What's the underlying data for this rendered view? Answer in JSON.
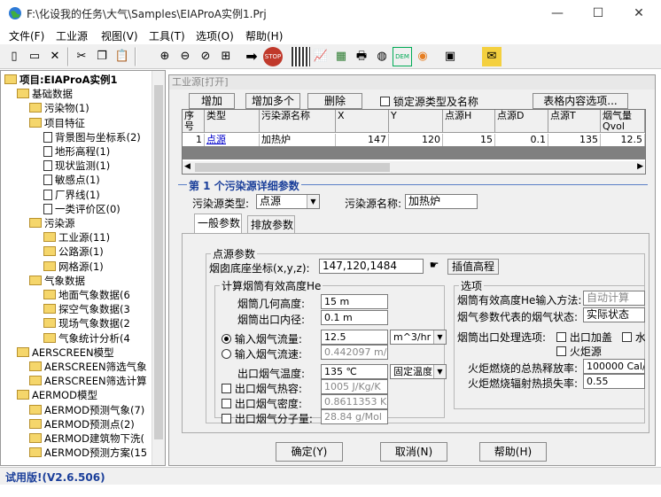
{
  "window": {
    "title": "F:\\化设我的任务\\大气\\Samples\\EIAProA实例1.Prj",
    "min": "—",
    "max": "☐",
    "close": "✕"
  },
  "menu": [
    "文件(F)",
    "工业源",
    "视图(V)",
    "工具(T)",
    "选项(O)",
    "帮助(H)"
  ],
  "toolbar": {
    "icons": [
      "new-icon",
      "open-icon",
      "delete-icon",
      "cut-icon",
      "copy-icon",
      "paste-icon",
      "zoom-in-icon",
      "zoom-out-icon",
      "zoom-fit-icon",
      "zoom-window-icon",
      "arrow-icon",
      "stop-icon",
      "grid-icon",
      "chart-icon",
      "calc-icon",
      "print-icon",
      "globe-icon",
      "dem-icon",
      "color-icon",
      "export-icon",
      "map-icon"
    ],
    "stop": "STOP",
    "dem": "DEM"
  },
  "tree": {
    "items": [
      {
        "label": "项目:EIAProA实例1",
        "type": "folder",
        "level": 0,
        "bold": true
      },
      {
        "label": "基础数据",
        "type": "folder",
        "level": 1
      },
      {
        "label": "污染物(1)",
        "type": "folder",
        "level": 2
      },
      {
        "label": "项目特征",
        "type": "folder",
        "level": 2
      },
      {
        "label": "背景图与坐标系(2)",
        "type": "doc",
        "level": 3
      },
      {
        "label": "地形高程(1)",
        "type": "doc",
        "level": 3
      },
      {
        "label": "现状监测(1)",
        "type": "doc",
        "level": 3
      },
      {
        "label": "敏感点(1)",
        "type": "doc",
        "level": 3
      },
      {
        "label": "厂界线(1)",
        "type": "doc",
        "level": 3
      },
      {
        "label": "一类评价区(0)",
        "type": "doc",
        "level": 3
      },
      {
        "label": "污染源",
        "type": "folder",
        "level": 2
      },
      {
        "label": "工业源(11)",
        "type": "folder",
        "level": 3
      },
      {
        "label": "公路源(1)",
        "type": "folder",
        "level": 3
      },
      {
        "label": "网格源(1)",
        "type": "folder",
        "level": 3
      },
      {
        "label": "气象数据",
        "type": "folder",
        "level": 2
      },
      {
        "label": "地面气象数据(6",
        "type": "folder",
        "level": 3
      },
      {
        "label": "探空气象数据(3",
        "type": "folder",
        "level": 3
      },
      {
        "label": "现场气象数据(2",
        "type": "folder",
        "level": 3
      },
      {
        "label": "气象统计分析(4",
        "type": "folder",
        "level": 3
      },
      {
        "label": "AERSCREEN模型",
        "type": "folder",
        "level": 1
      },
      {
        "label": "AERSCREEN筛选气象",
        "type": "folder",
        "level": 2
      },
      {
        "label": "AERSCREEN筛选计算",
        "type": "folder",
        "level": 2
      },
      {
        "label": "AERMOD模型",
        "type": "folder",
        "level": 1
      },
      {
        "label": "AERMOD预测气象(7)",
        "type": "folder",
        "level": 2
      },
      {
        "label": "AERMOD预测点(2)",
        "type": "folder",
        "level": 2
      },
      {
        "label": "AERMOD建筑物下洗(",
        "type": "folder",
        "level": 2
      },
      {
        "label": "AERMOD预测方案(15",
        "type": "folder",
        "level": 2
      }
    ]
  },
  "panel": {
    "title": "工业源[打开]",
    "buttons": {
      "add": "增加",
      "add_multi": "增加多个",
      "delete": "删除",
      "lock": "锁定源类型及名称",
      "table_options": "表格内容选项..."
    },
    "grid": {
      "headers": [
        "序号",
        "类型",
        "污染源名称",
        "X",
        "Y",
        "点源H",
        "点源D",
        "点源T",
        "烟气量Qvol"
      ],
      "row": [
        "1",
        "点源",
        "加热炉",
        "147",
        "120",
        "15",
        "0.1",
        "135",
        "12.5"
      ]
    },
    "detail_title": "第 1 个污染源详细参数",
    "source_type_label": "污染源类型:",
    "source_type": "点源",
    "source_name_label": "污染源名称:",
    "source_name": "加热炉",
    "tabs": [
      "一般参数",
      "排放参数"
    ],
    "point_group": "点源参数",
    "base_coord_label": "烟囱底座坐标(x,y,z):",
    "base_coord": "147,120,1484",
    "interp_btn": "插值高程",
    "calc_group": "计算烟筒有效高度He",
    "stack_h_label": "烟筒几何高度:",
    "stack_h": "15 m",
    "stack_d_label": "烟筒出口内径:",
    "stack_d": "0.1 m",
    "flow_label": "输入烟气流量:",
    "flow": "12.5",
    "flow_unit": "m^3/hr",
    "vel_label": "输入烟气流速:",
    "vel": "0.442097 m/s",
    "temp_label": "出口烟气温度:",
    "temp": "135 ℃",
    "temp_mode": "固定温度",
    "cp_label": "出口烟气热容:",
    "cp": "1005 J/Kg/K",
    "dens_label": "出口烟气密度:",
    "dens": "0.8611353 Kg",
    "mw_label": "出口烟气分子量:",
    "mw": "28.84 g/Mol",
    "opt_group": "选项",
    "he_method_label": "烟筒有效高度He输入方法:",
    "he_method": "自动计算",
    "state_label": "烟气参数代表的烟气状态:",
    "state": "实际状态",
    "outlet_label": "烟筒出口处理选项:",
    "cap": "出口加盖",
    "horiz": "水平",
    "flare": "火炬源",
    "heat_label": "火炬燃烧的总热释放率:",
    "heat": "100000 Cal/s",
    "loss_label": "火炬燃烧辐射热损失率:",
    "loss": "0.55",
    "ok": "确定(Y)",
    "cancel": "取消(N)",
    "help": "帮助(H)"
  },
  "status": "试用版!(V2.6.506)"
}
